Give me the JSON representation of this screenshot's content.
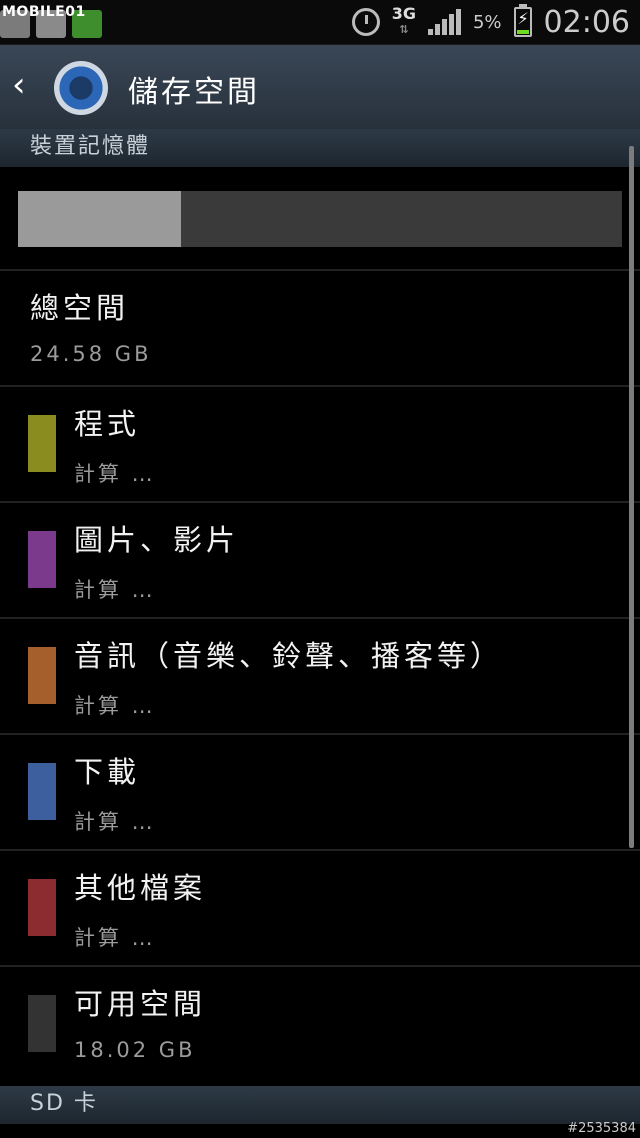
{
  "status_bar": {
    "watermark_logo": "MOBILE01",
    "network": "3G",
    "battery_pct": "5%",
    "time": "02:06"
  },
  "action_bar": {
    "title": "儲存空間",
    "back_icon": "chevron-left-icon",
    "app_icon": "gear-icon"
  },
  "device_section": {
    "header": "裝置記憶體",
    "usage_fraction": 0.27,
    "total": {
      "label": "總空間",
      "value": "24.58 GB"
    },
    "items": [
      {
        "label": "程式",
        "value": "計算 …",
        "color": "#8a8c1f"
      },
      {
        "label": "圖片、影片",
        "value": "計算 …",
        "color": "#7b3a8c"
      },
      {
        "label": "音訊（音樂、鈴聲、播客等）",
        "value": "計算 …",
        "color": "#a45f2d"
      },
      {
        "label": "下載",
        "value": "計算 …",
        "color": "#3e5f9e"
      },
      {
        "label": "其他檔案",
        "value": "計算 …",
        "color": "#8c2c30"
      },
      {
        "label": "可用空間",
        "value": "18.02 GB",
        "color": "#333333"
      }
    ]
  },
  "sd_section": {
    "header": "SD 卡"
  },
  "footer": {
    "watermark_id": "#2535384"
  }
}
